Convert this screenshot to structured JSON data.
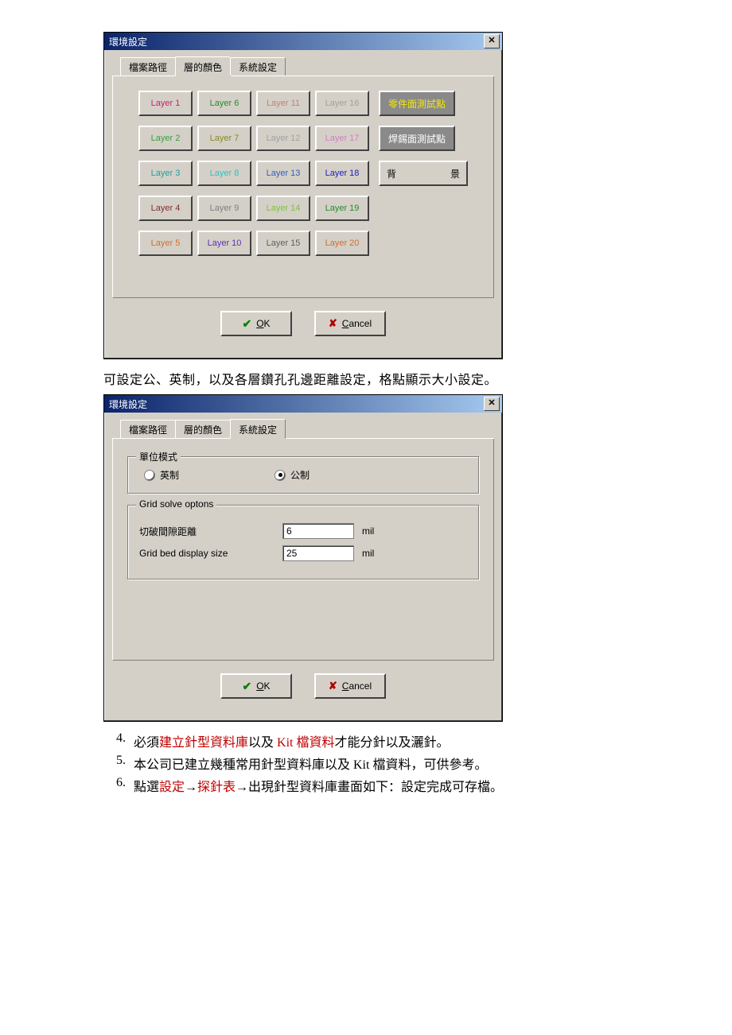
{
  "dialog1": {
    "title": "環境設定",
    "close": "✕",
    "tabs": {
      "t1": "檔案路徑",
      "t2": "層的顏色",
      "t3": "系統設定"
    },
    "layers": {
      "c1": [
        "Layer 1",
        "Layer 2",
        "Layer 3",
        "Layer 4",
        "Layer 5"
      ],
      "c2": [
        "Layer 6",
        "Layer 7",
        "Layer 8",
        "Layer 9",
        "Layer 10"
      ],
      "c3": [
        "Layer 11",
        "Layer 12",
        "Layer 13",
        "Layer 14",
        "Layer 15"
      ],
      "c4": [
        "Layer 16",
        "Layer 17",
        "Layer 18",
        "Layer 19",
        "Layer 20"
      ]
    },
    "layer_colors": {
      "c1": [
        "#d02070",
        "#3aa03a",
        "#20a0a0",
        "#803030",
        "#d07030"
      ],
      "c2": [
        "#2a8a2a",
        "#8a8a20",
        "#30c0c0",
        "#808080",
        "#6030b0"
      ],
      "c3": [
        "#c08080",
        "#a0a0a0",
        "#3060c0",
        "#80c040",
        "#606060"
      ],
      "c4": [
        "#a0a0a0",
        "#d080c0",
        "#2020c0",
        "#2a8a2a",
        "#d07030"
      ]
    },
    "side": {
      "s1": "零件面測試點",
      "s2": "焊錫面測試點",
      "s3a": "背",
      "s3b": "景"
    },
    "ok_label": "OK",
    "cancel_label": "Cancel"
  },
  "para1": "可設定公、英制，以及各層鑽孔孔邊距離設定，格點顯示大小設定。",
  "dialog2": {
    "title": "環境設定",
    "close": "✕",
    "tabs": {
      "t1": "檔案路徑",
      "t2": "層的顏色",
      "t3": "系統設定"
    },
    "unit_group": "單位模式",
    "radio_imperial": "英制",
    "radio_metric": "公制",
    "grid_group": "Grid solve optons",
    "row1_label": "切破間隙距離",
    "row1_value": "6",
    "row1_unit": "mil",
    "row2_label": "Grid bed display size",
    "row2_value": "25",
    "row2_unit": "mil",
    "ok_label": "OK",
    "cancel_label": "Cancel"
  },
  "list": {
    "n4": "4.",
    "n5": "5.",
    "n6": "6.",
    "i4a": "必須",
    "i4b": "建立針型資料庫",
    "i4c": "以及 ",
    "i4d": "Kit 檔資料",
    "i4e": "才能分針以及灑針。",
    "i5": "本公司已建立幾種常用針型資料庫以及 Kit 檔資料，可供參考。",
    "i6a": "點選",
    "i6b": "設定",
    "i6c": "→",
    "i6d": "探針表",
    "i6e": "→出現針型資料庫畫面如下：設定完成可存檔。"
  }
}
